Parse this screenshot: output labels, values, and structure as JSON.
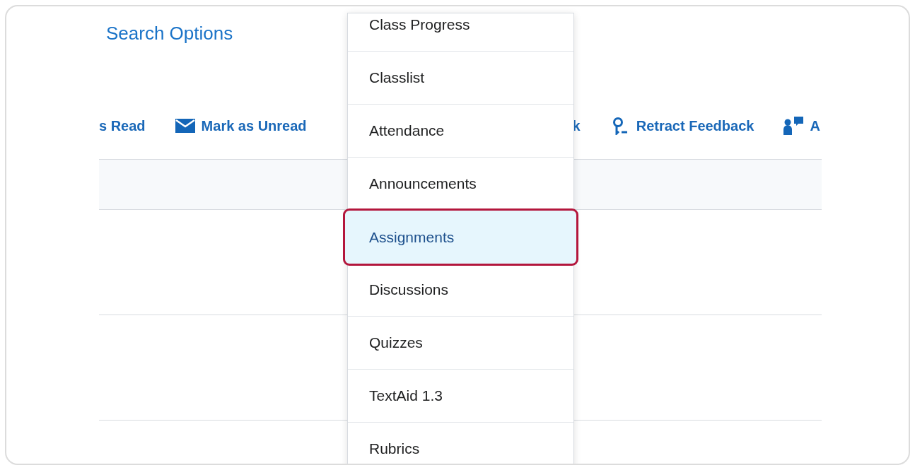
{
  "search_options_link": "Search Options",
  "toolbar": [
    {
      "kind": "text",
      "label": "s Read"
    },
    {
      "kind": "mail",
      "label": "Mark as Unread"
    },
    {
      "kind": "text",
      "label": "k"
    },
    {
      "kind": "ribbon",
      "label": "Retract Feedback"
    },
    {
      "kind": "person",
      "label": "A"
    }
  ],
  "menu_items": [
    {
      "label": "Class Progress",
      "selected": false
    },
    {
      "label": "Classlist",
      "selected": false
    },
    {
      "label": "Attendance",
      "selected": false
    },
    {
      "label": "Announcements",
      "selected": false
    },
    {
      "label": "Assignments",
      "selected": true
    },
    {
      "label": "Discussions",
      "selected": false
    },
    {
      "label": "Quizzes",
      "selected": false
    },
    {
      "label": "TextAid 1.3",
      "selected": false
    },
    {
      "label": "Rubrics",
      "selected": false
    }
  ]
}
